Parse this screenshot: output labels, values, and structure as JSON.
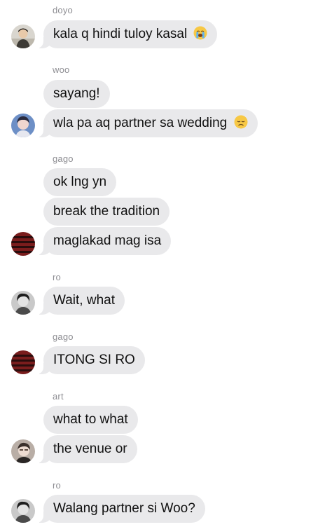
{
  "messages": [
    {
      "sender": "doyo",
      "lines": [
        "kala q hindi tuloy kasal"
      ],
      "last_emoji": "loudly-crying-face-emoji"
    },
    {
      "sender": "woo",
      "lines": [
        "sayang!",
        "wla pa aq partner sa wedding"
      ],
      "last_emoji": "disappointed-face-emoji"
    },
    {
      "sender": "gago",
      "lines": [
        "ok lng yn",
        "break the tradition",
        "maglakad mag isa"
      ]
    },
    {
      "sender": "ro",
      "lines": [
        "Wait, what"
      ]
    },
    {
      "sender": "gago",
      "lines": [
        "ITONG SI RO"
      ]
    },
    {
      "sender": "art",
      "lines": [
        "what to what",
        "the venue or"
      ]
    },
    {
      "sender": "ro",
      "lines": [
        "Walang partner si Woo?"
      ]
    }
  ],
  "icons": {
    "avatar_doyo": "boy-portrait-avatar",
    "avatar_woo": "blue-toned-portrait-avatar",
    "avatar_gago": "red-striped-shirt-avatar",
    "avatar_ro": "grayscale-portrait-avatar",
    "avatar_art": "pale-portrait-avatar"
  },
  "colors": {
    "bubble": "#e9e9eb",
    "sender_label": "#8e8e93",
    "text": "#111111",
    "background": "#ffffff"
  }
}
